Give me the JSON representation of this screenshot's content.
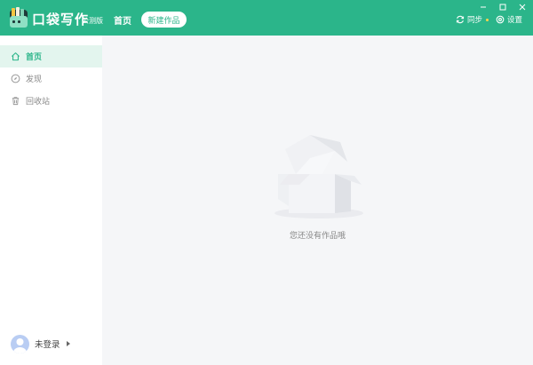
{
  "app": {
    "name": "口袋写作",
    "edition": "公测版"
  },
  "header": {
    "nav_home": "首页",
    "new_work": "新建作品",
    "sync": "同步",
    "settings": "设置",
    "sync_status_color": "#ffd54a"
  },
  "window_controls": {
    "minimize": "minimize-icon",
    "maximize": "maximize-icon",
    "close": "close-icon"
  },
  "sidebar": {
    "items": [
      {
        "label": "首页",
        "icon": "home-icon",
        "active": true
      },
      {
        "label": "发现",
        "icon": "compass-icon",
        "active": false
      },
      {
        "label": "回收站",
        "icon": "trash-icon",
        "active": false
      }
    ],
    "user_label": "未登录"
  },
  "main": {
    "empty_message": "您还没有作品哦"
  },
  "colors": {
    "brand": "#2bb58a",
    "sidebar_active_bg": "#e3f5ee",
    "background": "#f5f6f8"
  }
}
